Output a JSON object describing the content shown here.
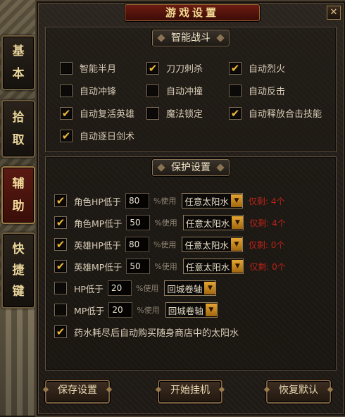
{
  "tabs": [
    {
      "label": "基\n本",
      "active": false
    },
    {
      "label": "拾\n取",
      "active": false
    },
    {
      "label": "辅\n助",
      "active": true
    },
    {
      "label": "快\n捷\n键",
      "active": false
    }
  ],
  "window": {
    "title": "游戏设置",
    "close": "✕"
  },
  "combat": {
    "title": "智能战斗",
    "options": [
      {
        "label": "智能半月",
        "checked": false
      },
      {
        "label": "刀刀刺杀",
        "checked": true
      },
      {
        "label": "自动烈火",
        "checked": true
      },
      {
        "label": "自动冲锋",
        "checked": false
      },
      {
        "label": "自动冲撞",
        "checked": false
      },
      {
        "label": "自动反击",
        "checked": false
      },
      {
        "label": "自动复活英雄",
        "checked": true
      },
      {
        "label": "魔法锁定",
        "checked": false
      },
      {
        "label": "自动释放合击技能",
        "checked": true
      },
      {
        "label": "自动逐日剑术",
        "checked": true
      }
    ]
  },
  "protect": {
    "title": "保护设置",
    "use_word": "%使用",
    "rows": [
      {
        "label": "角色HP低于",
        "value": "80",
        "item": "任意太阳水",
        "remain": "仅剩: 4个",
        "checked": true
      },
      {
        "label": "角色MP低于",
        "value": "50",
        "item": "任意太阳水",
        "remain": "仅剩: 4个",
        "checked": true
      },
      {
        "label": "英雄HP低于",
        "value": "80",
        "item": "任意太阳水",
        "remain": "仅剩: 0个",
        "checked": true
      },
      {
        "label": "英雄MP低于",
        "value": "50",
        "item": "任意太阳水",
        "remain": "仅剩: 0个",
        "checked": true
      },
      {
        "label": "HP低于",
        "value": "20",
        "item": "回城卷轴",
        "remain": "",
        "checked": false
      },
      {
        "label": "MP低于",
        "value": "20",
        "item": "回城卷轴",
        "remain": "",
        "checked": false
      }
    ],
    "auto_buy": {
      "label": "药水耗尽后自动购买随身商店中的太阳水",
      "checked": true
    }
  },
  "buttons": {
    "save": "保存设置",
    "start": "开始挂机",
    "restore": "恢复默认"
  },
  "check_glyph": "✔"
}
